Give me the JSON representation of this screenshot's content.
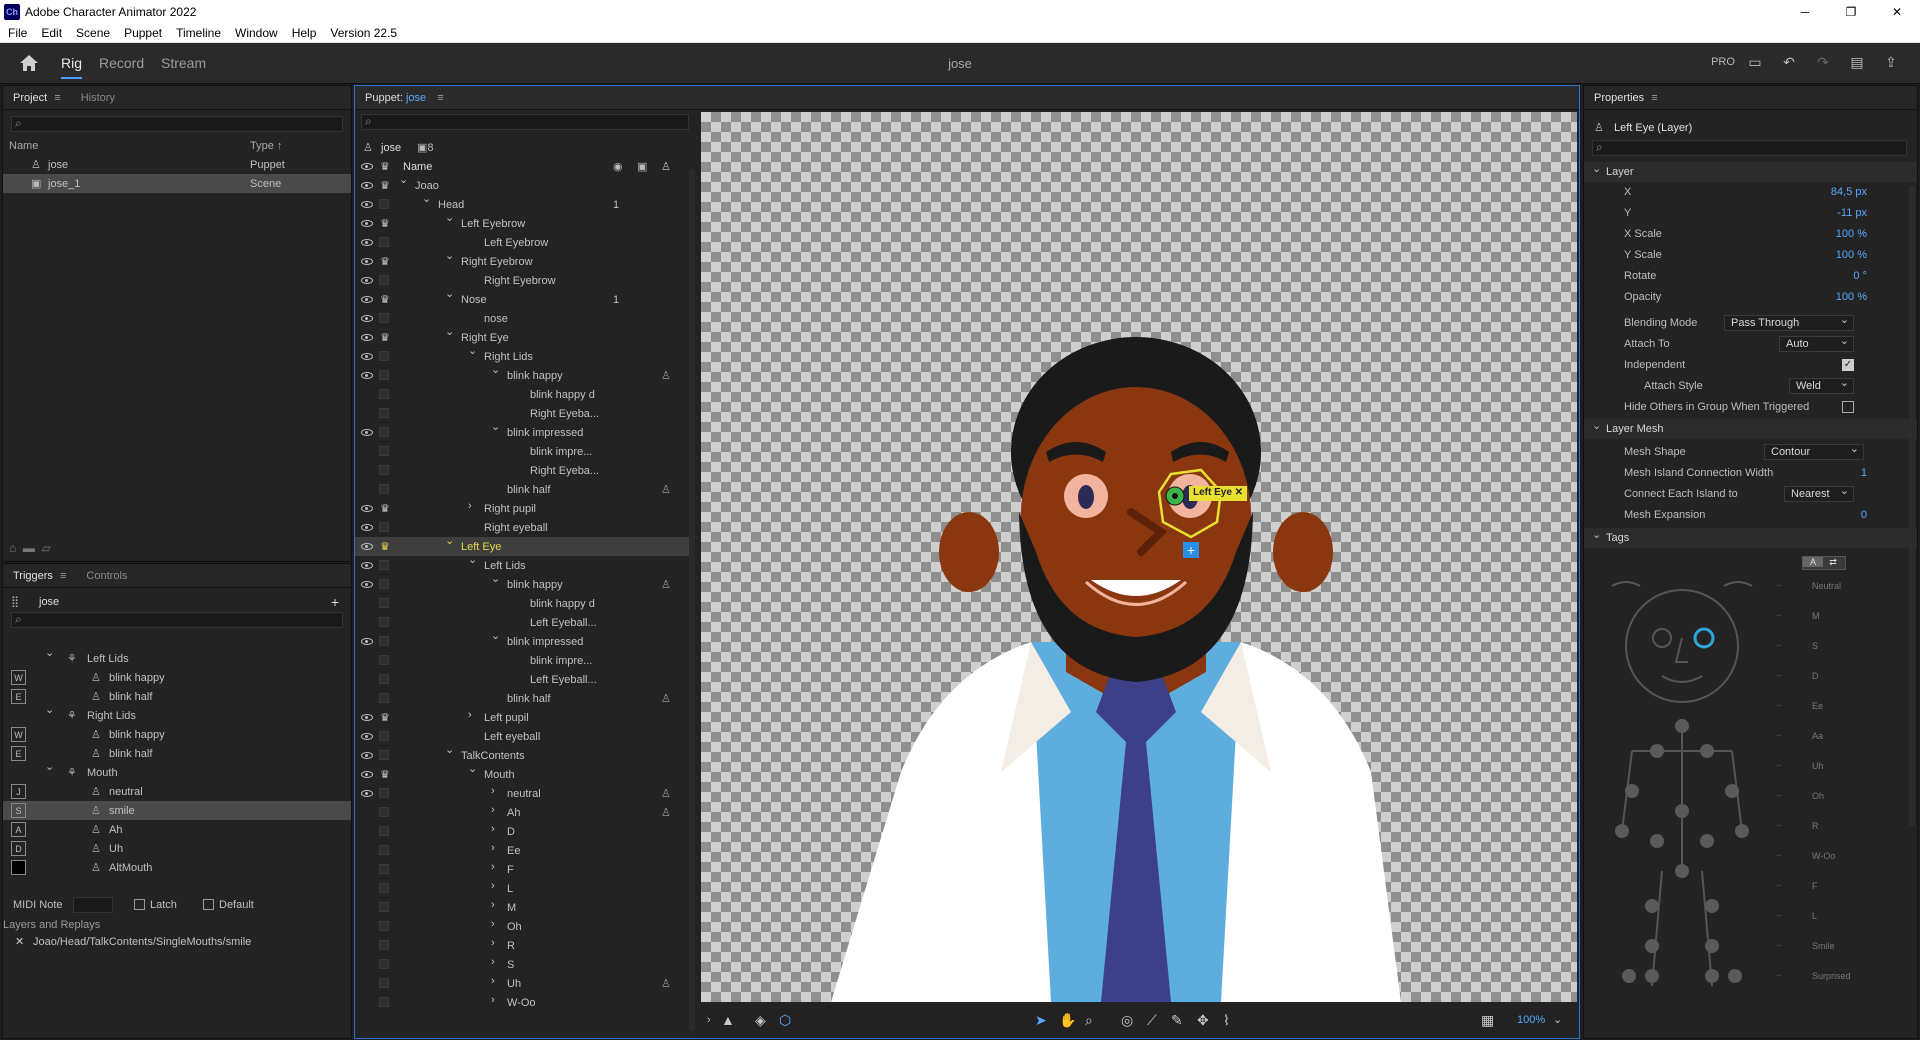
{
  "window": {
    "title": "Adobe Character Animator 2022",
    "icon": "Ch"
  },
  "menu": [
    "File",
    "Edit",
    "Scene",
    "Puppet",
    "Timeline",
    "Window",
    "Help",
    "Version 22.5"
  ],
  "workspace": {
    "tabs": [
      "Rig",
      "Record",
      "Stream"
    ],
    "active": "Rig",
    "doc_title": "jose",
    "pro_label": "PRO"
  },
  "project": {
    "tabs": [
      "Project",
      "History"
    ],
    "cols": [
      "Name",
      "Type"
    ],
    "items": [
      {
        "name": "jose",
        "type": "Puppet"
      },
      {
        "name": "jose_1",
        "type": "Scene"
      }
    ]
  },
  "triggers": {
    "tabs": [
      "Triggers",
      "Controls"
    ],
    "puppet": "jose",
    "items": [
      {
        "key": "",
        "label": "Left Lids",
        "indent": 1,
        "group": true
      },
      {
        "key": "W",
        "label": "blink happy",
        "indent": 2
      },
      {
        "key": "E",
        "label": "blink half",
        "indent": 2
      },
      {
        "key": "",
        "label": "Right Lids",
        "indent": 1,
        "group": true
      },
      {
        "key": "W",
        "label": "blink happy",
        "indent": 2
      },
      {
        "key": "E",
        "label": "blink half",
        "indent": 2
      },
      {
        "key": "",
        "label": "Mouth",
        "indent": 1,
        "group": true
      },
      {
        "key": "J",
        "label": "neutral",
        "indent": 2
      },
      {
        "key": "S",
        "label": "smile",
        "indent": 2,
        "selected": true
      },
      {
        "key": "A",
        "label": "Ah",
        "indent": 2
      },
      {
        "key": "D",
        "label": "Uh",
        "indent": 2
      },
      {
        "key": "■",
        "label": "AltMouth",
        "indent": 2
      }
    ],
    "midi_label": "MIDI Note",
    "latch": "Latch",
    "default": "Default",
    "layers_label": "Layers and Replays",
    "layer_path": "Joao/Head/TalkContents/SingleMouths/smile"
  },
  "puppet": {
    "header": "Puppet:",
    "name": "jose",
    "count": "8",
    "name_col": "Name",
    "rows": [
      {
        "l": "Joao",
        "i": 0,
        "e": 1,
        "c": 1,
        "x": 1
      },
      {
        "l": "Head",
        "i": 1,
        "e": 1,
        "x": 1,
        "n": "1"
      },
      {
        "l": "Left Eyebrow",
        "i": 2,
        "e": 1,
        "c": 1,
        "x": 1
      },
      {
        "l": "Left Eyebrow",
        "i": 3,
        "e": 1
      },
      {
        "l": "Right Eyebrow",
        "i": 2,
        "e": 1,
        "c": 1,
        "x": 1
      },
      {
        "l": "Right Eyebrow",
        "i": 3,
        "e": 1
      },
      {
        "l": "Nose",
        "i": 2,
        "e": 1,
        "c": 1,
        "x": 1,
        "n": "1"
      },
      {
        "l": "nose",
        "i": 3,
        "e": 1
      },
      {
        "l": "Right Eye",
        "i": 2,
        "e": 1,
        "c": 1,
        "x": 1
      },
      {
        "l": "Right Lids",
        "i": 3,
        "e": 1,
        "x": 1
      },
      {
        "l": "blink happy",
        "i": 4,
        "e": 1,
        "x": 1,
        "t": 1
      },
      {
        "l": "blink happy d",
        "i": 5
      },
      {
        "l": "Right Eyeba...",
        "i": 5
      },
      {
        "l": "blink impressed",
        "i": 4,
        "e": 1,
        "x": 1
      },
      {
        "l": "blink impre...",
        "i": 5
      },
      {
        "l": "Right Eyeba...",
        "i": 5
      },
      {
        "l": "blink half",
        "i": 4,
        "t": 1
      },
      {
        "l": "Right pupil",
        "i": 3,
        "e": 1,
        "c": 1,
        "r": 1
      },
      {
        "l": "Right eyeball",
        "i": 3,
        "e": 1
      },
      {
        "l": "Left Eye",
        "i": 2,
        "e": 1,
        "c": 1,
        "x": 1,
        "s": 1
      },
      {
        "l": "Left Lids",
        "i": 3,
        "e": 1,
        "x": 1
      },
      {
        "l": "blink happy",
        "i": 4,
        "e": 1,
        "x": 1,
        "t": 1
      },
      {
        "l": "blink happy d",
        "i": 5
      },
      {
        "l": "Left Eyeball...",
        "i": 5
      },
      {
        "l": "blink impressed",
        "i": 4,
        "e": 1,
        "x": 1
      },
      {
        "l": "blink impre...",
        "i": 5
      },
      {
        "l": "Left Eyeball...",
        "i": 5
      },
      {
        "l": "blink half",
        "i": 4,
        "t": 1
      },
      {
        "l": "Left pupil",
        "i": 3,
        "e": 1,
        "c": 1,
        "r": 1
      },
      {
        "l": "Left eyeball",
        "i": 3,
        "e": 1
      },
      {
        "l": "TalkContents",
        "i": 2,
        "e": 1,
        "x": 1
      },
      {
        "l": "Mouth",
        "i": 3,
        "e": 1,
        "c": 1,
        "x": 1
      },
      {
        "l": "neutral",
        "i": 4,
        "e": 1,
        "r": 1,
        "t": 1
      },
      {
        "l": "Ah",
        "i": 4,
        "r": 1,
        "t": 1
      },
      {
        "l": "D",
        "i": 4,
        "r": 1
      },
      {
        "l": "Ee",
        "i": 4,
        "r": 1
      },
      {
        "l": "F",
        "i": 4,
        "r": 1
      },
      {
        "l": "L",
        "i": 4,
        "r": 1
      },
      {
        "l": "M",
        "i": 4,
        "r": 1
      },
      {
        "l": "Oh",
        "i": 4,
        "r": 1
      },
      {
        "l": "R",
        "i": 4,
        "r": 1
      },
      {
        "l": "S",
        "i": 4,
        "r": 1
      },
      {
        "l": "Uh",
        "i": 4,
        "r": 1,
        "t": 1
      },
      {
        "l": "W-Oo",
        "i": 4,
        "r": 1
      }
    ]
  },
  "canvas": {
    "handle_label": "Left Eye",
    "zoom": "100%"
  },
  "properties": {
    "header": "Properties",
    "layer_title": "Left Eye (Layer)",
    "layer_section": "Layer",
    "layer_props": [
      {
        "n": "X",
        "v": "84,5 px"
      },
      {
        "n": "Y",
        "v": "-11 px"
      },
      {
        "n": "X Scale",
        "v": "100 %"
      },
      {
        "n": "Y Scale",
        "v": "100 %"
      },
      {
        "n": "Rotate",
        "v": "0 °"
      },
      {
        "n": "Opacity",
        "v": "100 %"
      }
    ],
    "blending_label": "Blending Mode",
    "blending": "Pass Through",
    "attach_label": "Attach To",
    "attach": "Auto",
    "independent": "Independent",
    "attach_style_label": "Attach Style",
    "attach_style": "Weld",
    "hide_others": "Hide Others in Group When Triggered",
    "mesh_section": "Layer Mesh",
    "mesh_shape_label": "Mesh Shape",
    "mesh_shape": "Contour",
    "mesh_island_label": "Mesh Island Connection Width",
    "mesh_island": "1",
    "connect_label": "Connect Each Island to",
    "connect": "Nearest",
    "expansion_label": "Mesh Expansion",
    "expansion": "0",
    "tags_section": "Tags",
    "tag_list": [
      "Neutral",
      "M",
      "S",
      "D",
      "Ee",
      "Aa",
      "Uh",
      "Oh",
      "R",
      "W-Oo",
      "F",
      "L",
      "Smile",
      "Surprised"
    ]
  }
}
